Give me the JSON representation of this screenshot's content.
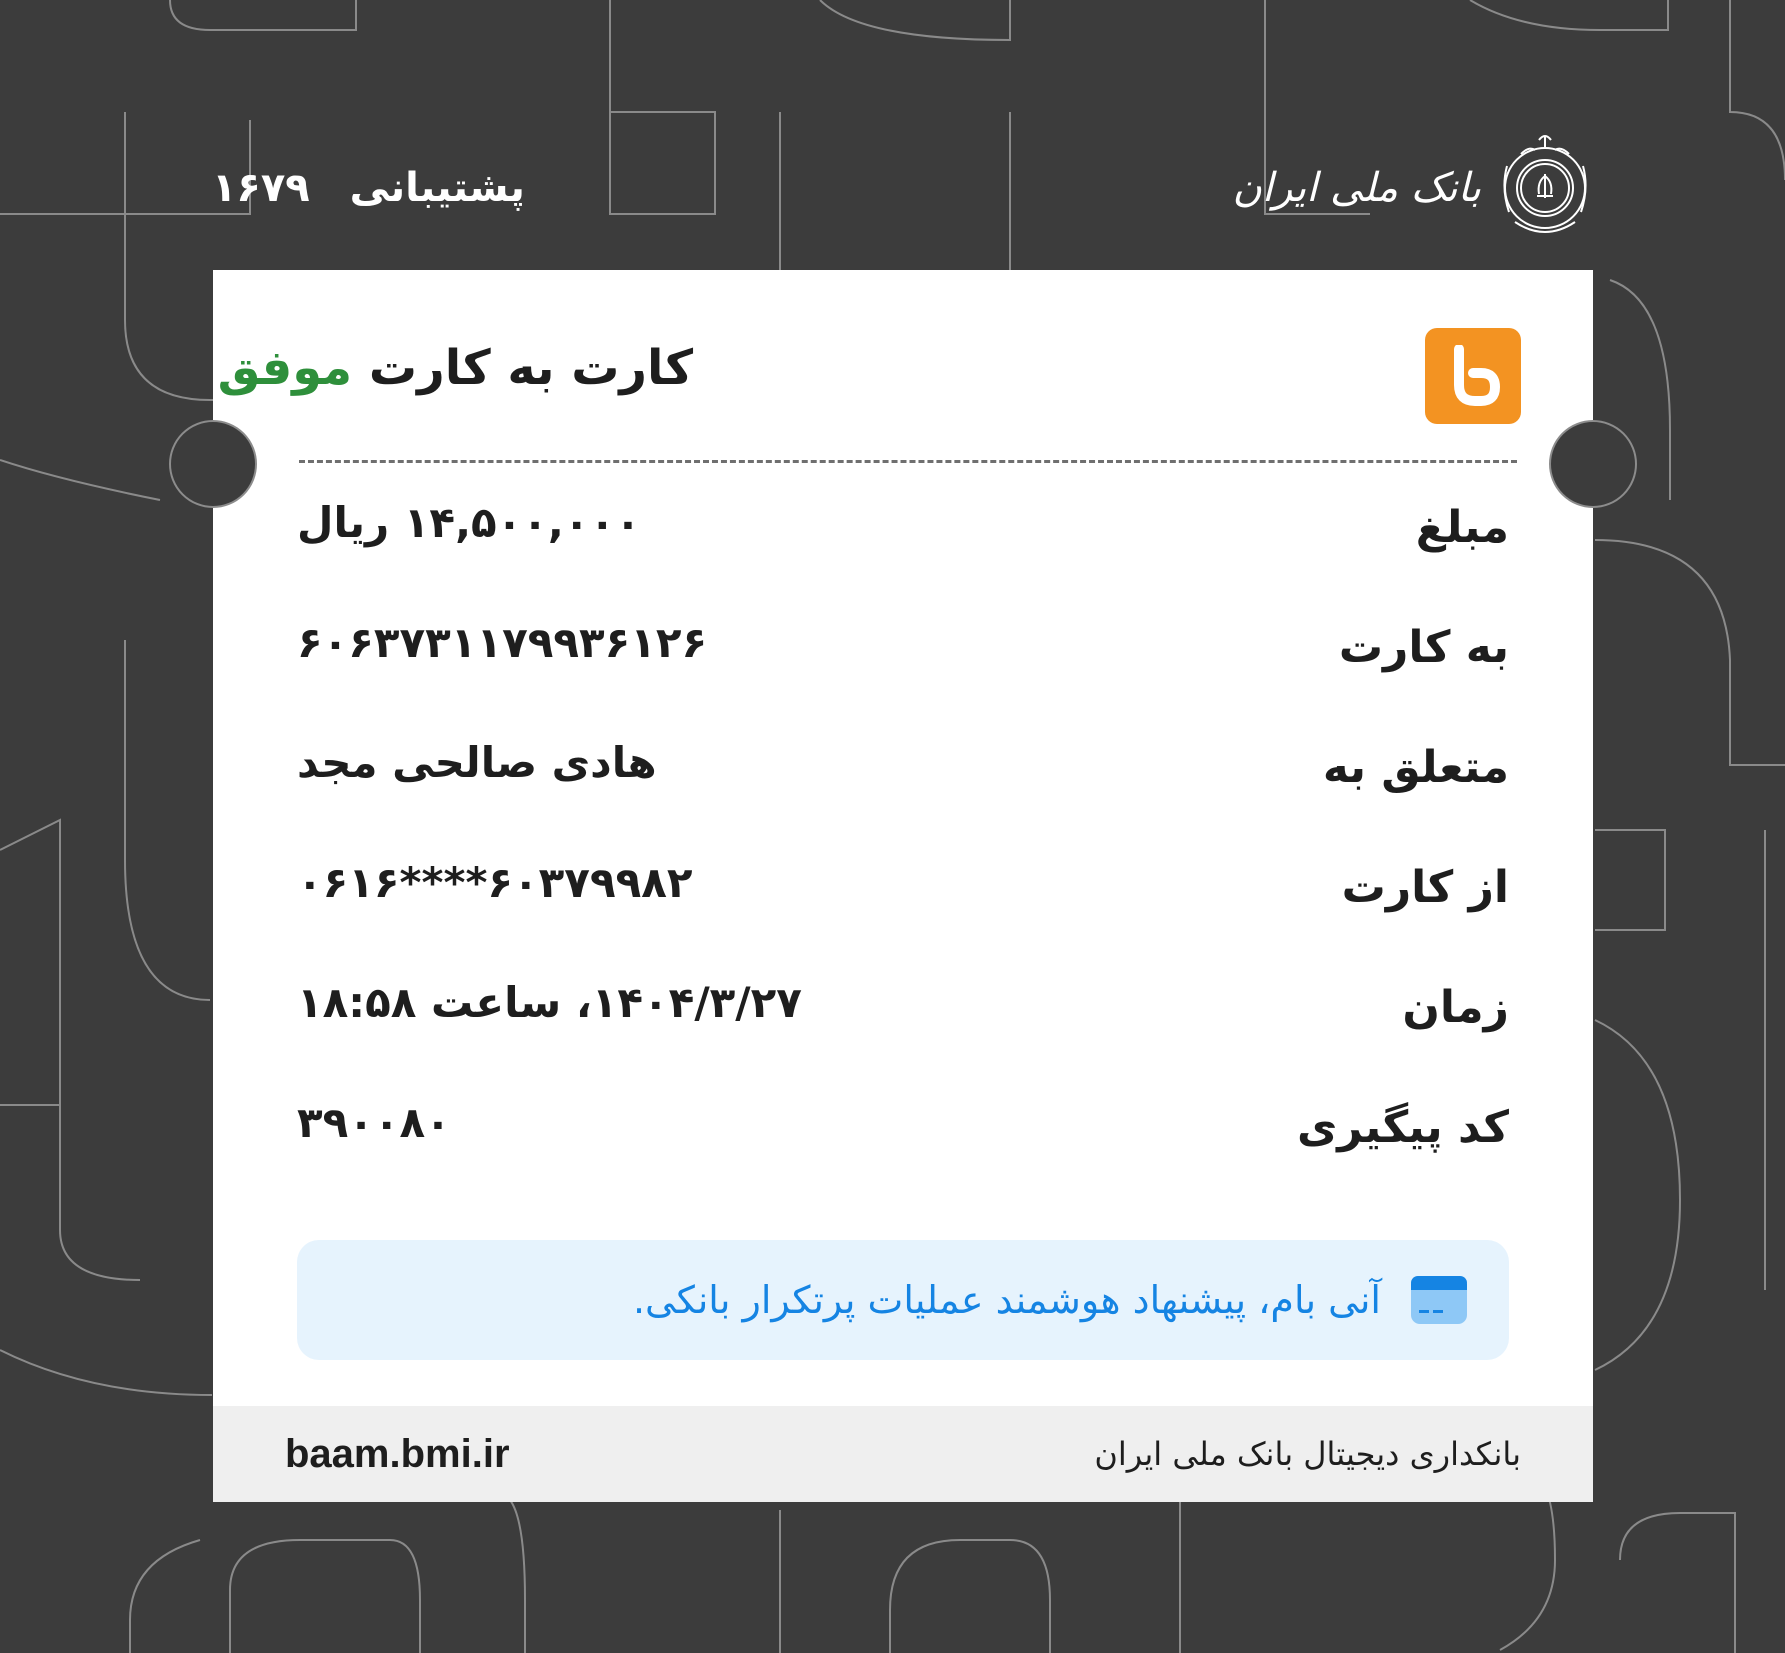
{
  "header": {
    "support_label": "پشتیبانی",
    "support_number": "۱۶۷۹",
    "bank_name": "بانک ملی ایران"
  },
  "receipt": {
    "title_prefix": "کارت به کارت",
    "status": "موفق",
    "rows": [
      {
        "label": "مبلغ",
        "value": "۱۴,۵۰۰,۰۰۰ ریال"
      },
      {
        "label": "به کارت",
        "value": "۶۰۶۳۷۳۱۱۷۹۹۳۶۱۲۶"
      },
      {
        "label": "متعلق به",
        "value": "هادی صالحی مجد"
      },
      {
        "label": "از کارت",
        "value": "۶۰۳۷۹۹۸۲****۰۶۱۶"
      },
      {
        "label": "زمان",
        "value": "۱۴۰۴/۳/۲۷، ساعت ۱۸:۵۸"
      },
      {
        "label": "کد پیگیری",
        "value": "۳۹۰۰۸۰"
      }
    ],
    "promo_text": "آنی بام، پیشنهاد هوشمند عملیات پرتکرار بانکی."
  },
  "footer": {
    "title": "بانکداری دیجیتال بانک ملی ایران",
    "url": "baam.bmi.ir"
  },
  "colors": {
    "background": "#3c3c3c",
    "status_green": "#2e8f3b",
    "baam_orange": "#f39322",
    "promo_blue": "#1584e3",
    "promo_bg": "#e6f3fd"
  },
  "icons": [
    "bmi-emblem-icon",
    "baam-logo-icon",
    "card-icon"
  ]
}
